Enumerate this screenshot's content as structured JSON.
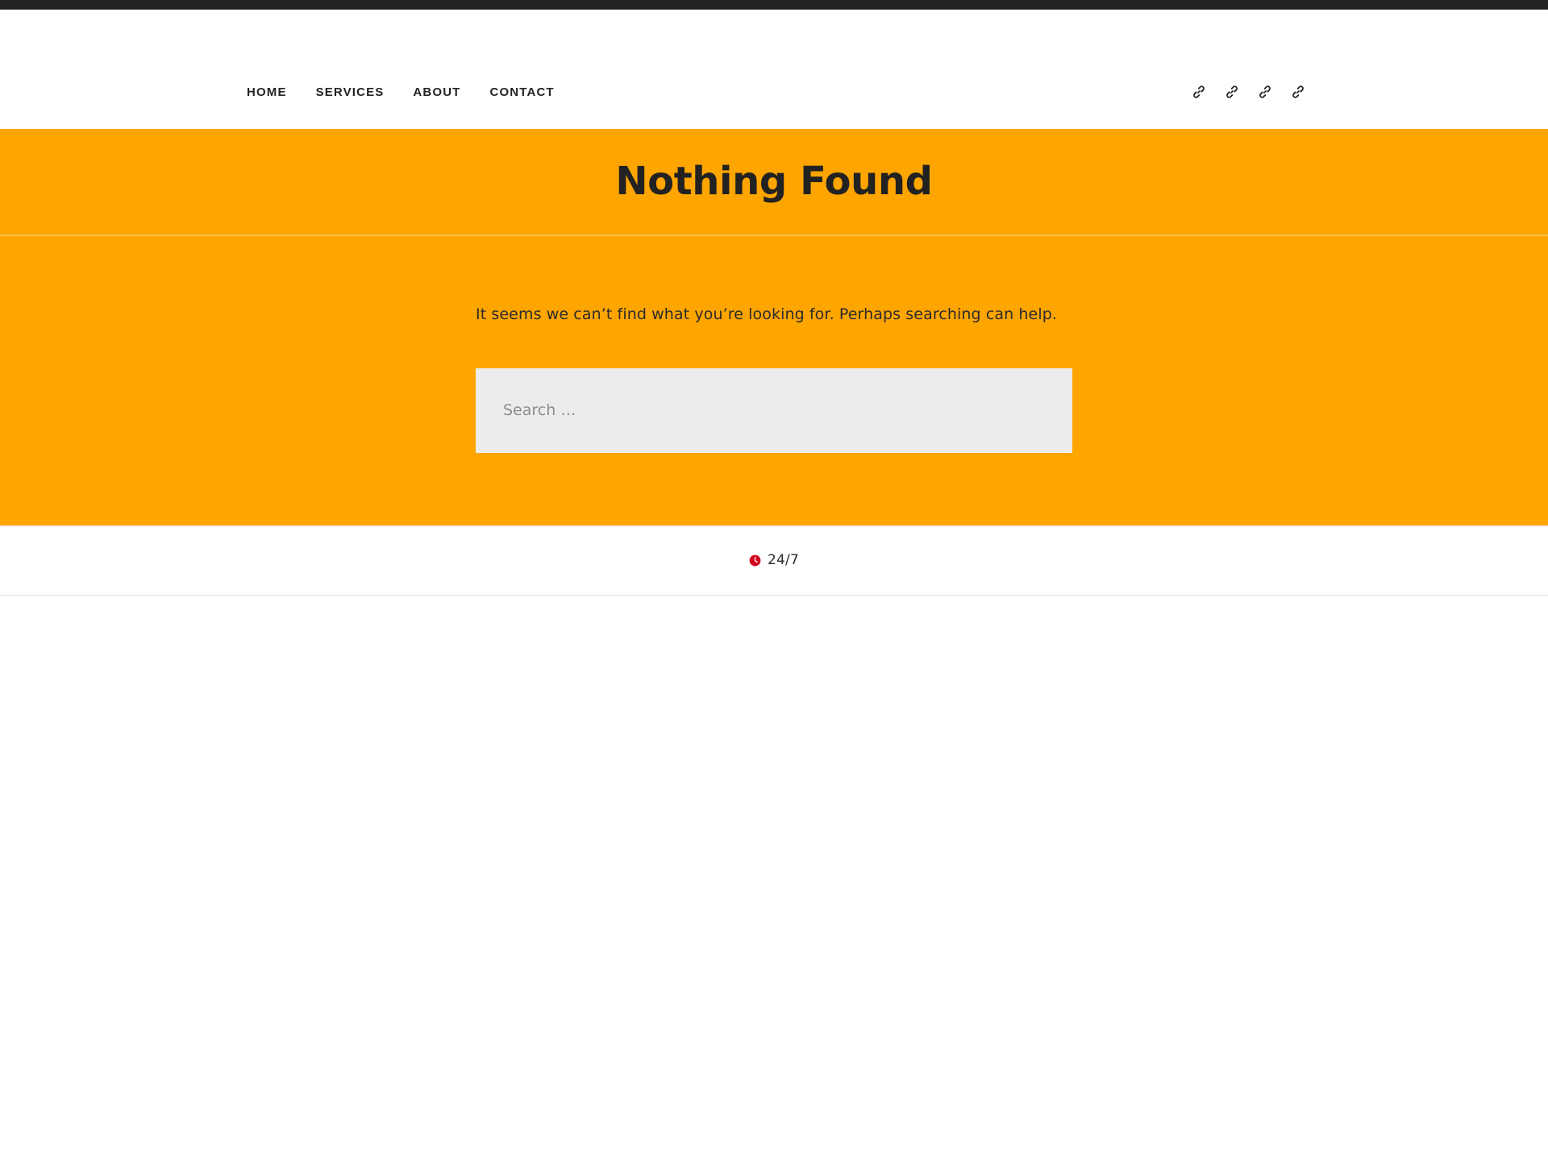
{
  "topbar": {
    "present": true,
    "color": "#222222"
  },
  "header": {
    "nav": {
      "items": [
        {
          "label": "HOME",
          "name": "nav-item-home"
        },
        {
          "label": "SERVICES",
          "name": "nav-item-services"
        },
        {
          "label": "ABOUT",
          "name": "nav-item-about"
        },
        {
          "label": "CONTACT",
          "name": "nav-item-contact"
        }
      ]
    },
    "social": {
      "items": [
        {
          "icon": "link-icon"
        },
        {
          "icon": "link-icon"
        },
        {
          "icon": "link-icon"
        },
        {
          "icon": "link-icon"
        }
      ]
    }
  },
  "hero": {
    "title": "Nothing Found",
    "background_color": "#ffa500",
    "title_color": "#222222"
  },
  "main": {
    "message": "It seems we can’t find what you’re looking for. Perhaps searching can help.",
    "search": {
      "value": "",
      "placeholder": "Search …",
      "field_background": "#ececec"
    }
  },
  "footer": {
    "hours_icon": "clock-icon",
    "hours_label": "24/7",
    "icon_color": "#d0021b"
  }
}
